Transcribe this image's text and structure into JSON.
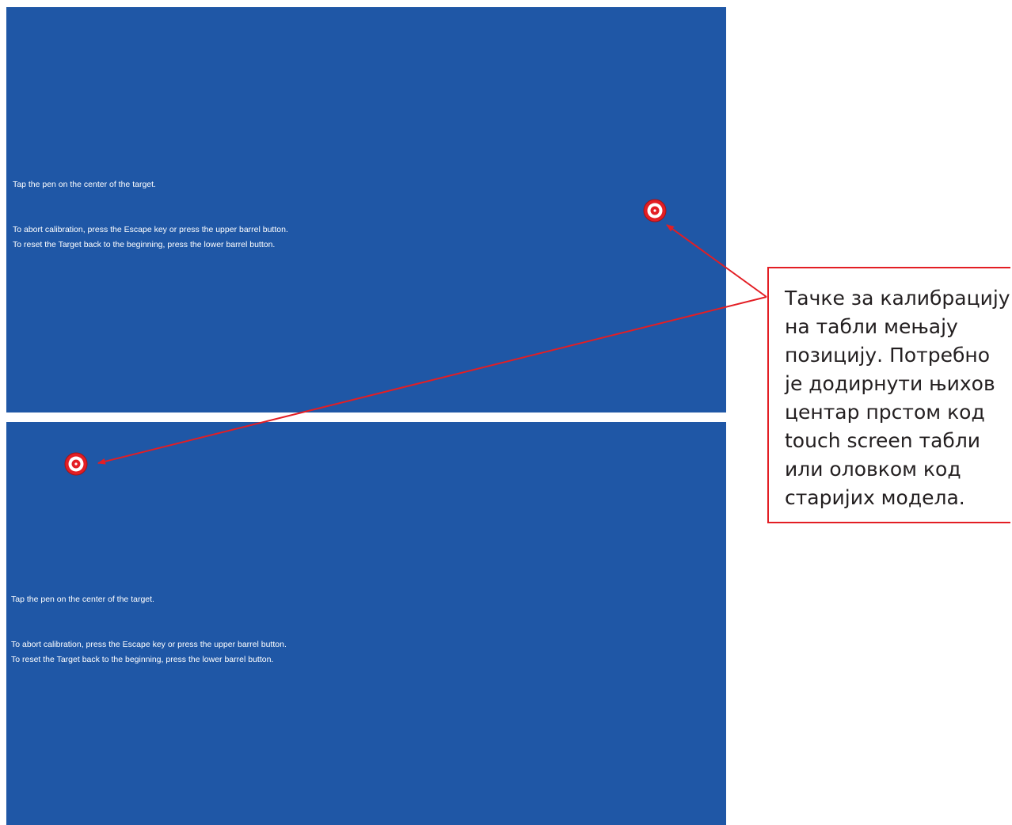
{
  "screens": [
    {
      "instructions": {
        "tap": "Tap the pen on the center of the target.",
        "abort": "To abort calibration, press the Escape key or press the upper barrel button.",
        "reset": "To reset the Target back to the beginning, press the lower barrel button."
      }
    },
    {
      "instructions": {
        "tap": "Tap the pen on the center of the target.",
        "abort": "To abort calibration, press the Escape key or press the upper barrel button.",
        "reset": "To reset the Target back to the beginning, press the lower barrel button."
      }
    }
  ],
  "callout": {
    "text": "Тачке за калибрацију на табли мењају позицију. Потребно је додирнути њихов центар прстом код touch screen табли или оловком код старијих модела."
  },
  "colors": {
    "screen_background": "#1f57a6",
    "annotation_red": "#e31e24",
    "target_red": "#e31e24"
  },
  "icons": {
    "target": "calibration-target-icon",
    "arrow": "arrow-pointer"
  }
}
